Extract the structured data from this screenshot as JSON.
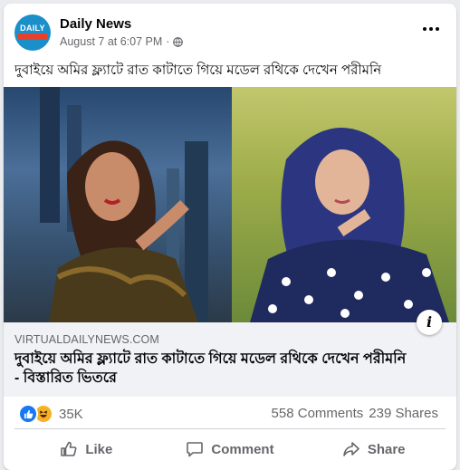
{
  "post": {
    "page_name": "Daily News",
    "avatar_text": "DAILY",
    "timestamp": "August 7 at 6:07 PM",
    "separator": "·",
    "privacy_icon": "globe-icon",
    "more_icon": "more-options-icon",
    "text": "দুবাইয়ে অমির ফ্ল্যাটে রাত কাটাতে গিয়ে মডেল রথিকে দেখেন পরীমনি"
  },
  "link_preview": {
    "domain": "VIRTUALDAILYNEWS.COM",
    "title": "দুবাইয়ে অমির ফ্ল্যাটে রাত কাটাতে গিয়ে মডেল রথিকে দেখেন পরীমনি - বিস্তারিত ভিতরে",
    "info_icon": "i"
  },
  "engagement": {
    "reaction_icons": [
      "like-reaction-icon",
      "haha-reaction-icon"
    ],
    "reaction_count": "35K",
    "comments": "558 Comments",
    "shares": "239 Shares"
  },
  "actions": {
    "like_label": "Like",
    "comment_label": "Comment",
    "share_label": "Share"
  },
  "colors": {
    "brand_blue": "#1877f2",
    "secondary_text": "#65676b",
    "link_box_bg": "#f0f2f5",
    "haha_yellow": "#f7b125"
  }
}
